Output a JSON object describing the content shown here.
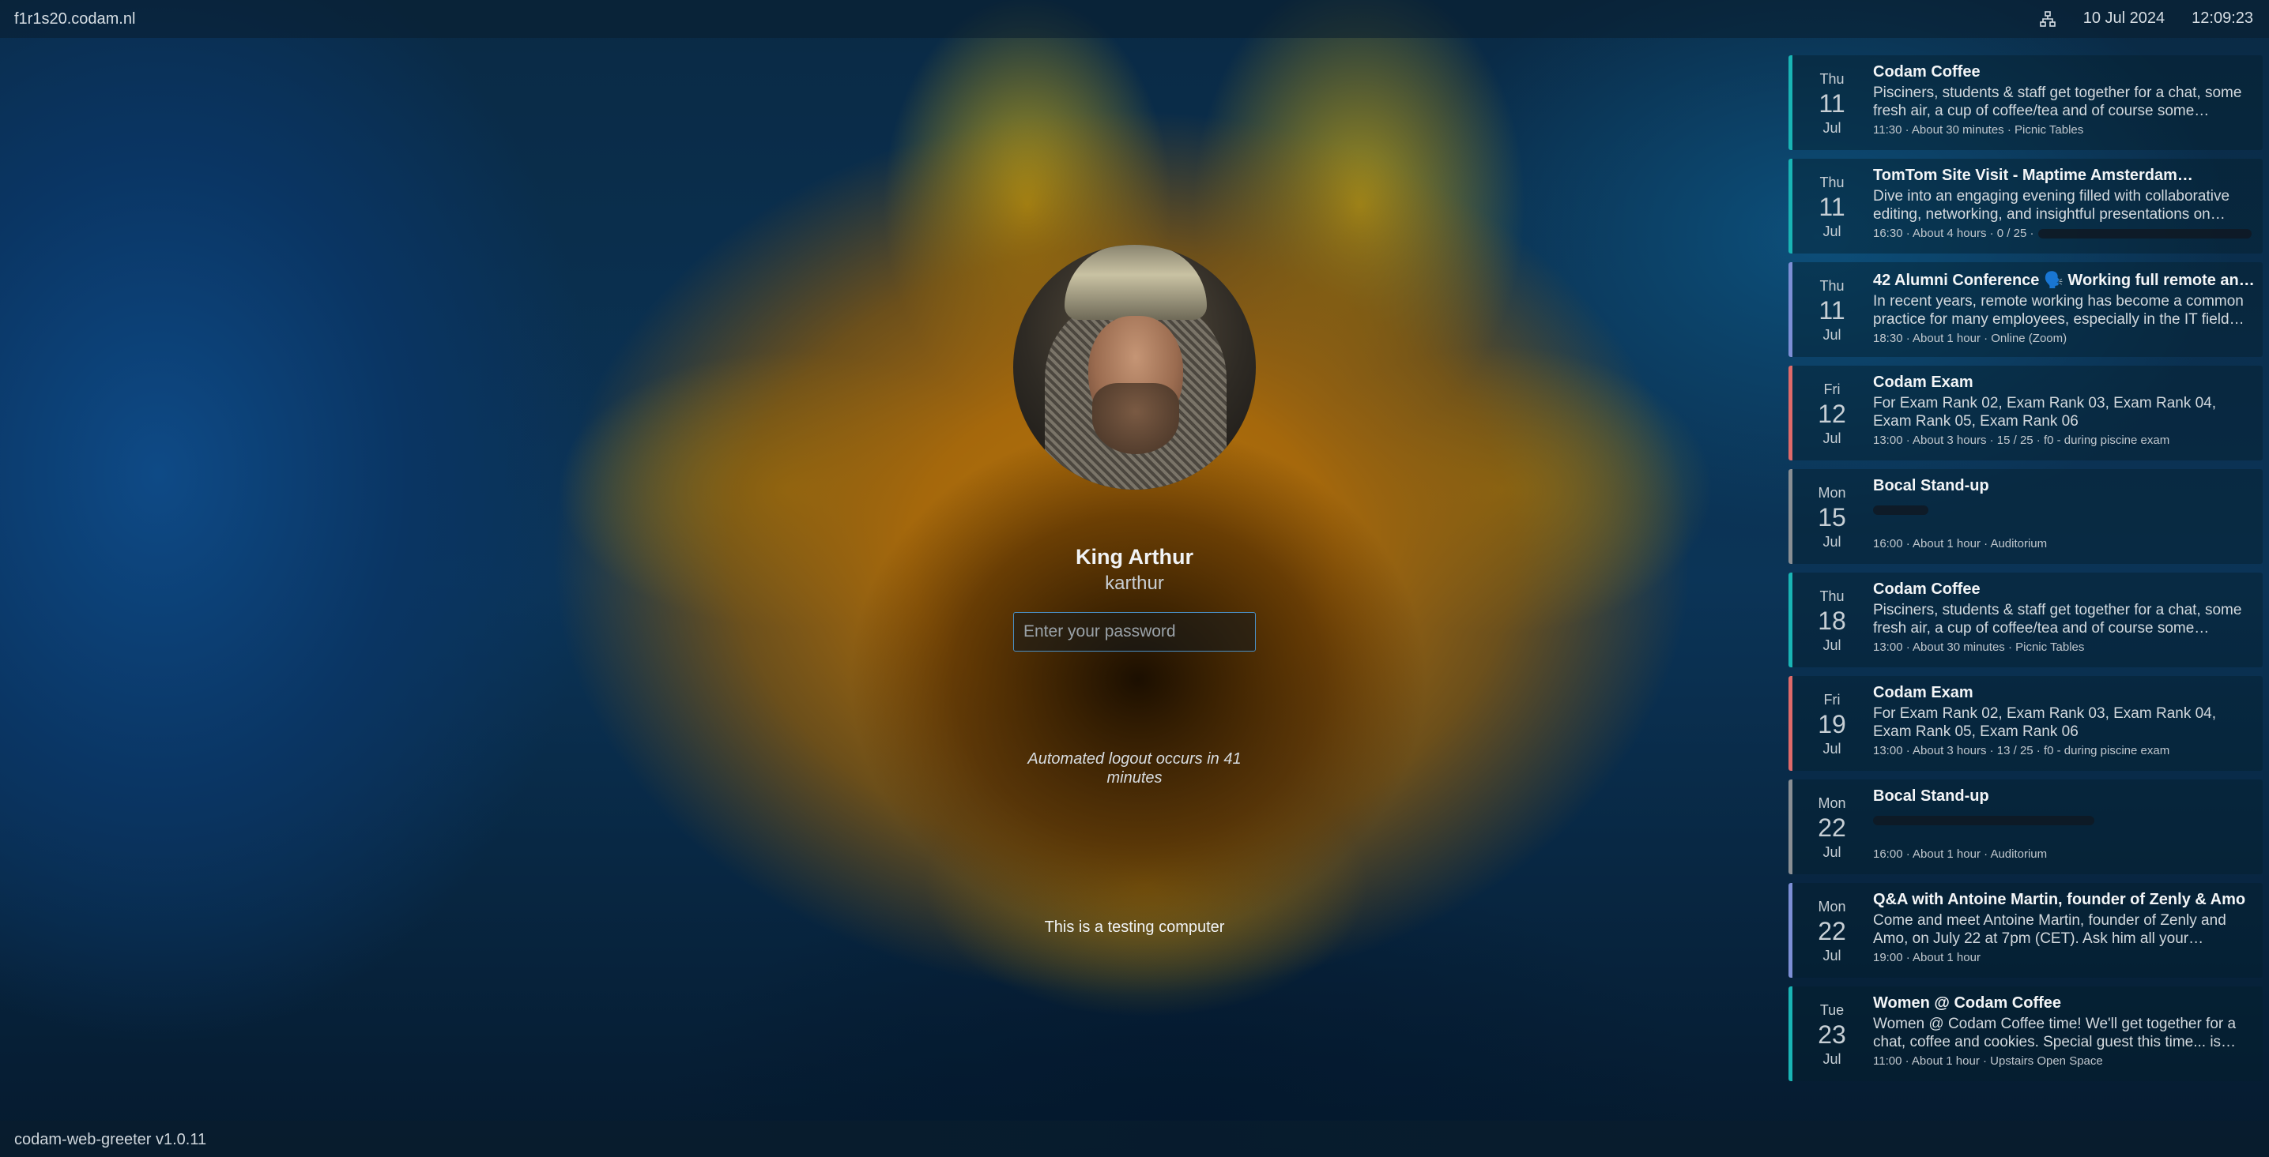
{
  "topbar": {
    "hostname": "f1r1s20.codam.nl",
    "network_icon": "network-icon",
    "date": "10 Jul 2024",
    "time": "12:09:23"
  },
  "login": {
    "display_name": "King Arthur",
    "username": "karthur",
    "password_placeholder": "Enter your password",
    "logout_notice": "Automated logout occurs in 41 minutes",
    "testing_notice": "This is a testing computer"
  },
  "footer": {
    "version": "codam-web-greeter v1.0.11"
  },
  "colors": {
    "coffee": "#19b5b5",
    "exam": "#e06a6a",
    "talk": "#7d8fd6",
    "standup": "#8a8f94"
  },
  "events": [
    {
      "dow": "Thu",
      "day": "11",
      "mon": "Jul",
      "title": "Codam Coffee",
      "desc": "Pisciners, students & staff get together for a chat, some fresh air, a cup of coffee/tea and of course some…",
      "meta": "11:30 · About 30 minutes · Picnic Tables",
      "color": "#19b5b5"
    },
    {
      "dow": "Thu",
      "day": "11",
      "mon": "Jul",
      "title": "TomTom Site Visit - Maptime Amsterdam…",
      "desc": "Dive into an engaging evening filled with collaborative editing, networking, and insightful presentations on…",
      "meta": "16:30 · About 4 hours · 0 / 25 ·",
      "color": "#19b5b5"
    },
    {
      "dow": "Thu",
      "day": "11",
      "mon": "Jul",
      "title": "42 Alumni Conference 🗣️ Working full remote and…",
      "desc": "In recent years, remote working has become a common practice for many employees, especially in the IT field…",
      "meta": "18:30 · About 1 hour · Online (Zoom)",
      "color": "#7d8fd6"
    },
    {
      "dow": "Fri",
      "day": "12",
      "mon": "Jul",
      "title": "Codam Exam",
      "desc": "For Exam Rank 02, Exam Rank 03, Exam Rank 04, Exam Rank 05, Exam Rank 06",
      "meta": "13:00 · About 3 hours · 15 / 25 · f0 - during piscine exam",
      "color": "#e06a6a"
    },
    {
      "dow": "Mon",
      "day": "15",
      "mon": "Jul",
      "title": "Bocal Stand-up",
      "desc": "",
      "meta": "16:00 · About 1 hour · Auditorium",
      "color": "#8a8f94"
    },
    {
      "dow": "Thu",
      "day": "18",
      "mon": "Jul",
      "title": "Codam Coffee",
      "desc": "Pisciners, students & staff get together for a chat, some fresh air, a cup of coffee/tea and of course some…",
      "meta": "13:00 · About 30 minutes · Picnic Tables",
      "color": "#19b5b5"
    },
    {
      "dow": "Fri",
      "day": "19",
      "mon": "Jul",
      "title": "Codam Exam",
      "desc": "For Exam Rank 02, Exam Rank 03, Exam Rank 04, Exam Rank 05, Exam Rank 06",
      "meta": "13:00 · About 3 hours · 13 / 25 · f0 - during piscine exam",
      "color": "#e06a6a"
    },
    {
      "dow": "Mon",
      "day": "22",
      "mon": "Jul",
      "title": "Bocal Stand-up",
      "desc": "",
      "meta": "16:00 · About 1 hour · Auditorium",
      "color": "#8a8f94"
    },
    {
      "dow": "Mon",
      "day": "22",
      "mon": "Jul",
      "title": "Q&A with Antoine Martin, founder of Zenly & Amo",
      "desc": "Come and meet Antoine Martin, founder of Zenly and Amo, on July 22 at 7pm (CET). Ask him all your…",
      "meta": "19:00 · About 1 hour",
      "color": "#7d8fd6"
    },
    {
      "dow": "Tue",
      "day": "23",
      "mon": "Jul",
      "title": "Women @ Codam Coffee",
      "desc": "Women @ Codam Coffee time! We'll get together for a chat, coffee and cookies. Special guest this time... is…",
      "meta": "11:00 · About 1 hour · Upstairs Open Space",
      "color": "#19b5b5"
    }
  ]
}
